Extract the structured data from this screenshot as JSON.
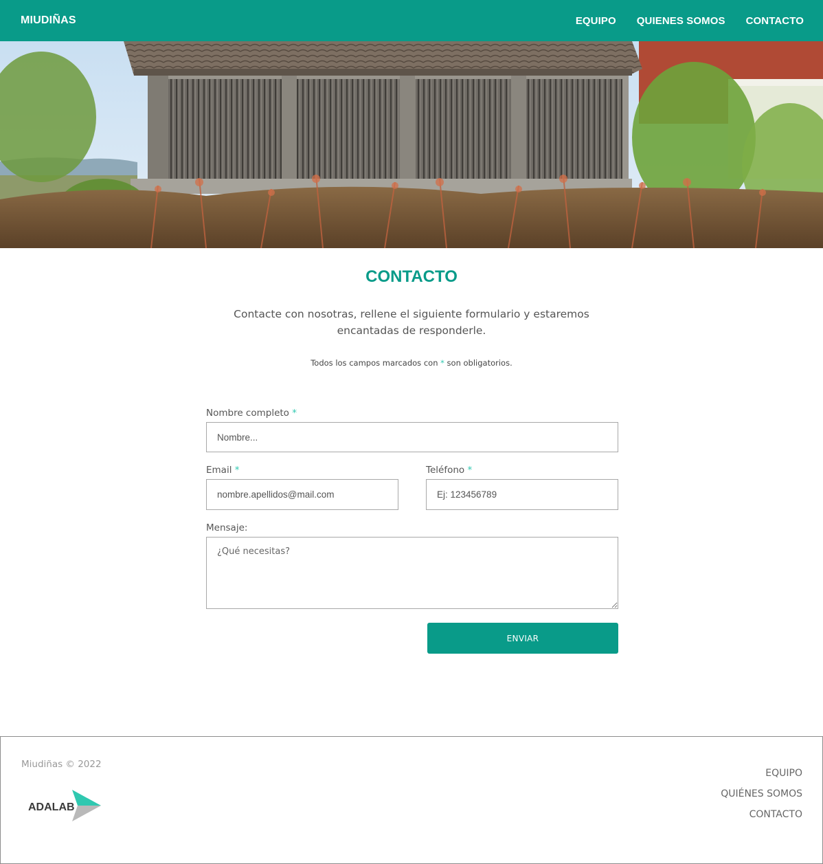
{
  "header": {
    "brand": "MIUDIÑAS",
    "nav": [
      "EQUIPO",
      "QUIENES SOMOS",
      "CONTACTO"
    ]
  },
  "hero": {
    "image_icon": "photo-horreo-granary",
    "accent": "#099b89"
  },
  "contact": {
    "title": "CONTACTO",
    "intro": "Contacte con nosotras, rellene el siguiente formulario y estaremos encantadas de responderle.",
    "required_note_before": "Todos los campos marcados con",
    "required_mark": "*",
    "required_note_after": "son obligatorios."
  },
  "form": {
    "name_label": "Nombre completo",
    "name_placeholder": "Nombre...",
    "email_label": "Email",
    "email_placeholder": "nombre.apellidos@mail.com",
    "phone_label": "Teléfono",
    "phone_placeholder": "Ej: 123456789",
    "message_label": "Mensaje:",
    "message_placeholder": "¿Qué necesitas?",
    "submit_label": "ENVIAR"
  },
  "footer": {
    "copyright": "Miudiñas © 2022",
    "logo_text": "ADALAB",
    "nav": [
      "EQUIPO",
      "QUIÉNES SOMOS",
      "CONTACTO"
    ]
  },
  "colors": {
    "primary": "#099b89",
    "required": "#2fc8b0",
    "border": "#a8a8a8"
  }
}
